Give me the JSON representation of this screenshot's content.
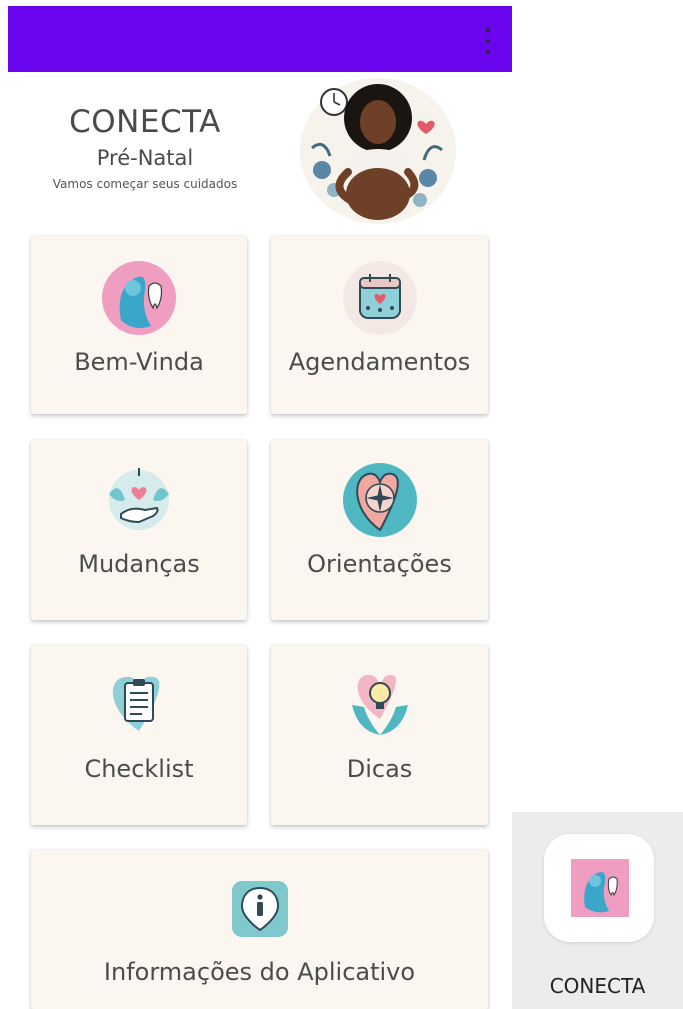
{
  "header": {
    "title": "CONECTA",
    "subtitle": "Pré-Natal",
    "tagline": "Vamos começar seus cuidados"
  },
  "colors": {
    "app_bar": "#6a05f0",
    "card_background": "#fbf6f0",
    "accent_teal": "#6fc6cc",
    "accent_pink": "#ef9dc1"
  },
  "menu": [
    {
      "label": "Bem-Vinda",
      "icon": "mother-tooth-icon"
    },
    {
      "label": "Agendamentos",
      "icon": "calendar-heart-icon"
    },
    {
      "label": "Mudanças",
      "icon": "hand-heart-icon"
    },
    {
      "label": "Orientações",
      "icon": "compass-heart-icon"
    },
    {
      "label": "Checklist",
      "icon": "clipboard-heart-icon"
    },
    {
      "label": "Dicas",
      "icon": "lightbulb-hands-icon"
    },
    {
      "label": "Informações do Aplicativo",
      "icon": "info-icon"
    }
  ],
  "launcher": {
    "app_name": "CONECTA",
    "icon": "conecta-app-icon"
  }
}
